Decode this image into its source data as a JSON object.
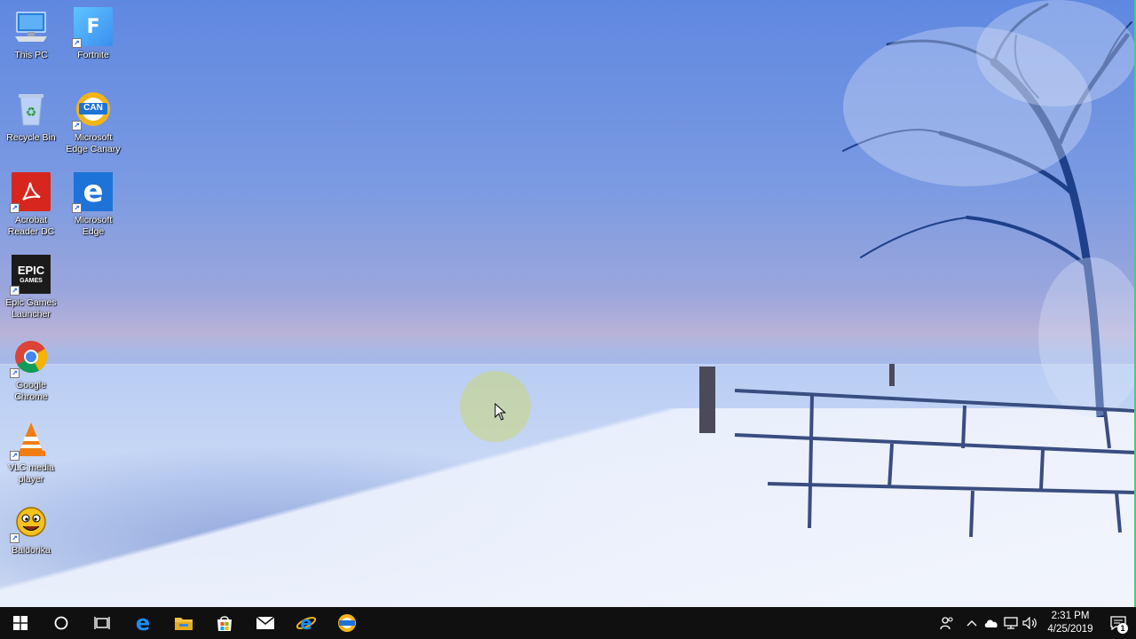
{
  "desktop": {
    "icons": [
      {
        "label": "This PC",
        "icon": "computer-icon"
      },
      {
        "label": "Fortnite",
        "icon": "fortnite-icon",
        "glyph": "F"
      },
      {
        "label": "Recycle Bin",
        "icon": "recycle-bin-icon"
      },
      {
        "label": "Microsoft Edge Canary",
        "icon": "edge-canary-icon",
        "glyph": "CAN"
      },
      {
        "label": "Acrobat Reader DC",
        "icon": "acrobat-icon"
      },
      {
        "label": "Microsoft Edge",
        "icon": "edge-icon",
        "glyph": "e"
      },
      {
        "label": "Epic Games Launcher",
        "icon": "epic-games-icon",
        "glyph_top": "EPIC",
        "glyph_bottom": "GAMES"
      },
      {
        "label": "Google Chrome",
        "icon": "chrome-icon"
      },
      {
        "label": "VLC media player",
        "icon": "vlc-icon"
      },
      {
        "label": "Baldorika",
        "icon": "baldorika-icon"
      }
    ]
  },
  "taskbar": {
    "start": "windows-start-icon",
    "search": "cortana-search-icon",
    "task_view": "task-view-icon",
    "pinned": [
      "edge-icon",
      "file-explorer-icon",
      "store-icon",
      "mail-icon",
      "internet-explorer-icon",
      "edge-canary-icon"
    ],
    "tray": {
      "people": "people-icon",
      "overflow": "chevron-up-icon",
      "onedrive": "cloud-icon",
      "network": "network-icon",
      "volume": "speaker-icon",
      "time": "2:31 PM",
      "date": "4/25/2019",
      "notification_count": "1"
    }
  },
  "colors": {
    "taskbar": "#101010",
    "edge_blue": "#1e73d8",
    "accent": "#0078d7"
  }
}
